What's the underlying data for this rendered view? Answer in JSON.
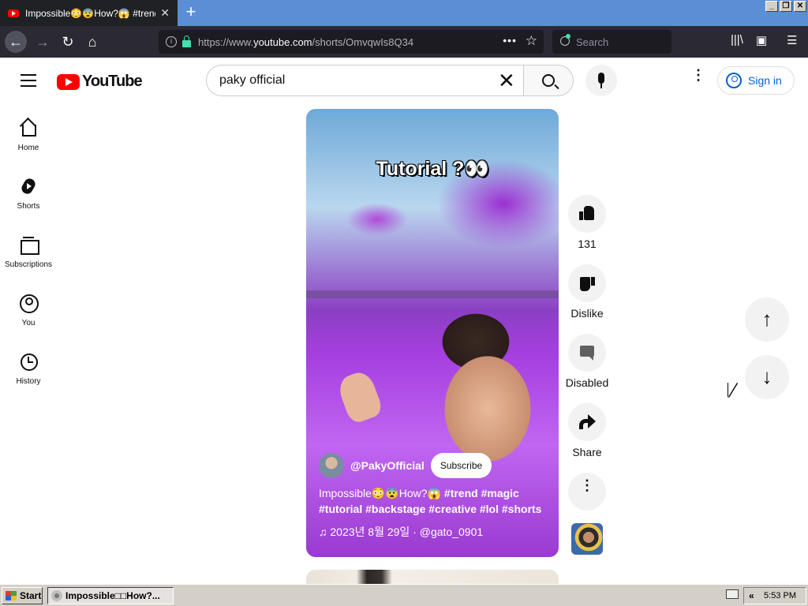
{
  "browser": {
    "tab_title": "Impossible😳😨How?😱 #trend #m",
    "tab_close": "✕",
    "new_tab": "+",
    "window_buttons": [
      "_",
      "❐",
      "✕"
    ],
    "url_prefix": "https://www.",
    "url_domain": "youtube.com",
    "url_path": "/shorts/OmvqwIs8Q34",
    "search_placeholder": "Search",
    "nav_icons": {
      "back": "←",
      "forward": "→",
      "reload": "↻",
      "home": "⌂",
      "page_actions": "•••",
      "bookmark": "☆",
      "library": "|||\\",
      "sidebar": "▣",
      "menu": "☰"
    }
  },
  "youtube": {
    "logo_text": "YouTube",
    "search_value": "paky official",
    "search_clear": "✕",
    "more_icon": "⋮",
    "sign_in": "Sign in"
  },
  "sidebar": {
    "items": [
      {
        "label": "Home",
        "icon": "home-icon"
      },
      {
        "label": "Shorts",
        "icon": "shorts-icon"
      },
      {
        "label": "Subscriptions",
        "icon": "subscriptions-icon"
      },
      {
        "label": "You",
        "icon": "you-icon"
      },
      {
        "label": "History",
        "icon": "history-icon"
      }
    ]
  },
  "short": {
    "overlay_title": "Tutorial ?👀",
    "channel": "@PakyOfficial",
    "subscribe": "Subscribe",
    "desc_plain": "Impossible😳😨How?😱 ",
    "desc_tags": "#trend #magic #tutorial #backstage #creative #lol #shorts",
    "music_line": "♫ 2023년 8월 29일 · @gato_0901"
  },
  "actions": {
    "likes": "131",
    "dislike": "Dislike",
    "comments": "Disabled",
    "share": "Share",
    "more": "⋮",
    "prev_arrow": "↑",
    "next_arrow": "↓"
  },
  "taskbar": {
    "start": "Start",
    "task_title": "Impossible□□How?...",
    "tray_chevron": "«",
    "clock": "5:53 PM"
  }
}
